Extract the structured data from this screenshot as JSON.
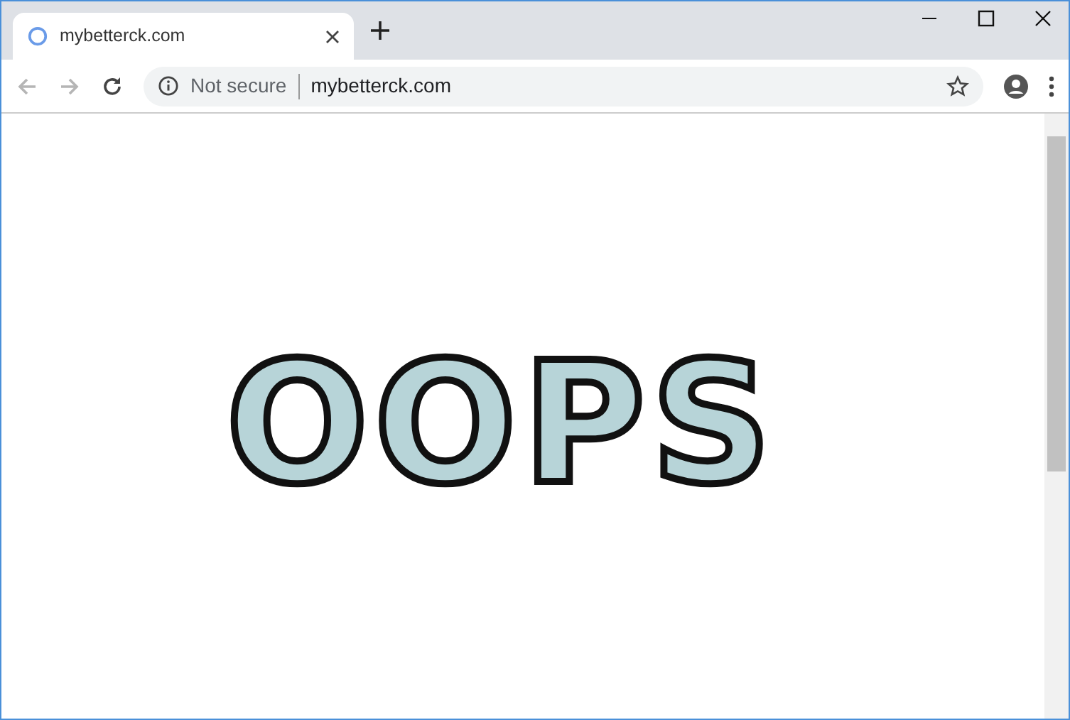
{
  "tabs": [
    {
      "title": "mybetterck.com",
      "selected": true
    }
  ],
  "toolbar": {
    "back_disabled": true,
    "forward_disabled": true
  },
  "address_bar": {
    "security": "Not secure",
    "url": "mybetterck.com"
  },
  "page": {
    "heading": "OOPS"
  }
}
